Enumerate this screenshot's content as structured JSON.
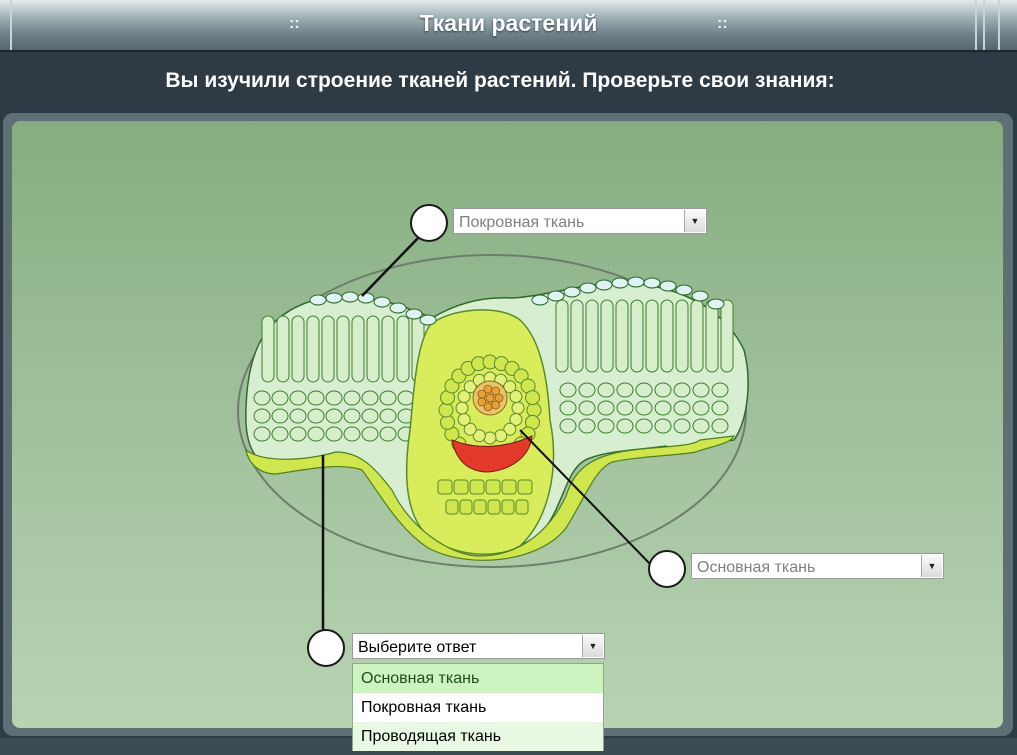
{
  "window": {
    "title": "Ткани растений",
    "deco_left": "::",
    "deco_right": "::"
  },
  "instruction": "Вы изучили строение тканей растений. Проверьте свои знания:",
  "selects": [
    {
      "value": "Покровная ткань",
      "state": "answered",
      "arrow_icon": "triangle-down"
    },
    {
      "value": "Основная ткань",
      "state": "answered",
      "arrow_icon": "triangle-down"
    },
    {
      "value": "Выберите ответ",
      "state": "open",
      "arrow_icon": "triangle-down"
    }
  ],
  "dropdown": {
    "options": [
      "Основная ткань",
      "Покровная ткань",
      "Проводящая ткань"
    ],
    "highlighted": "Основная ткань"
  },
  "colors": {
    "epidermis": "#dff3f2",
    "mesophyll": "#d6eecb",
    "bundle_sheath": "#cfe64e",
    "phloem": "#e23a2a",
    "xylem": "#e8a13a",
    "cell_wall": "#3e7e2e"
  }
}
